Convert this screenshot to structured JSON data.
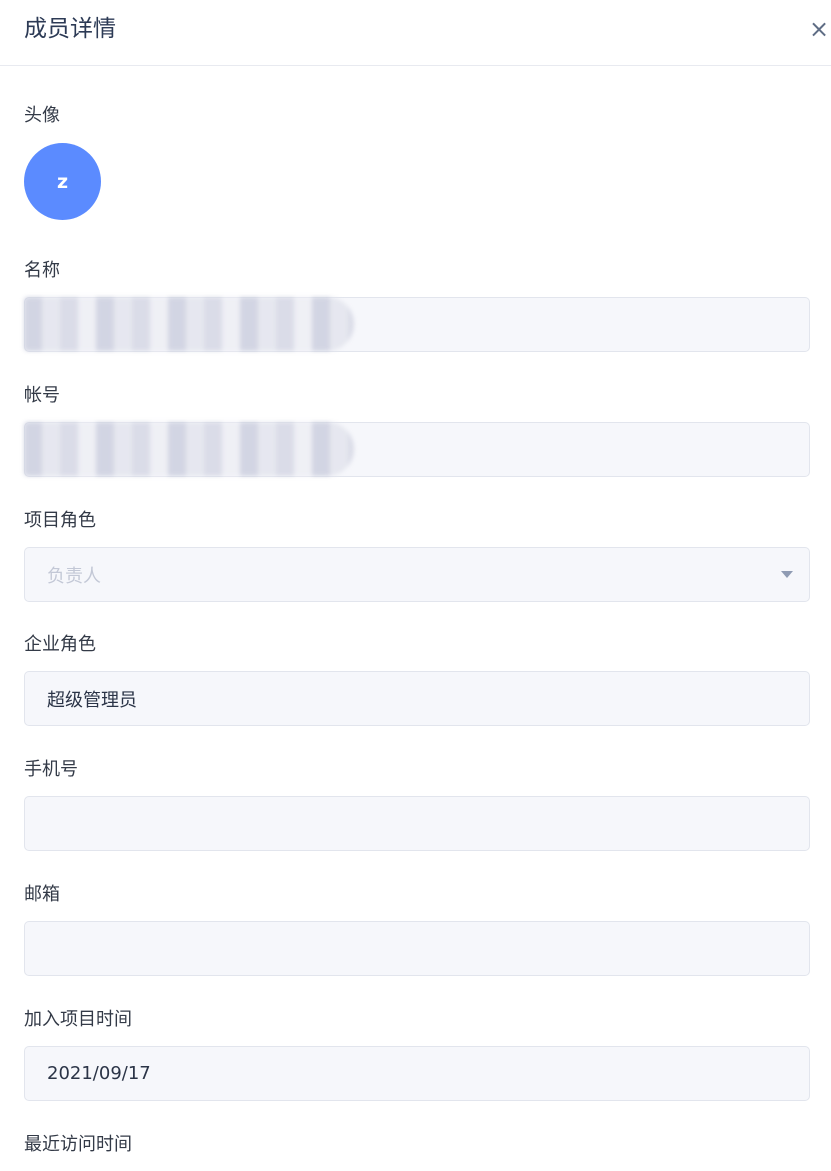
{
  "dialog": {
    "title": "成员详情",
    "close_symbol": "×"
  },
  "avatar": {
    "label": "头像",
    "initial": "z",
    "color": "#5b8bff"
  },
  "fields": {
    "name": {
      "label": "名称",
      "value": ""
    },
    "account": {
      "label": "帐号",
      "value": ""
    },
    "project_role": {
      "label": "项目角色",
      "value": "负责人"
    },
    "enterprise_role": {
      "label": "企业角色",
      "value": "超级管理员"
    },
    "phone": {
      "label": "手机号",
      "value": ""
    },
    "email": {
      "label": "邮箱",
      "value": ""
    },
    "join_time": {
      "label": "加入项目时间",
      "value": "2021/09/17"
    },
    "last_visit": {
      "label": "最近访问时间"
    }
  }
}
